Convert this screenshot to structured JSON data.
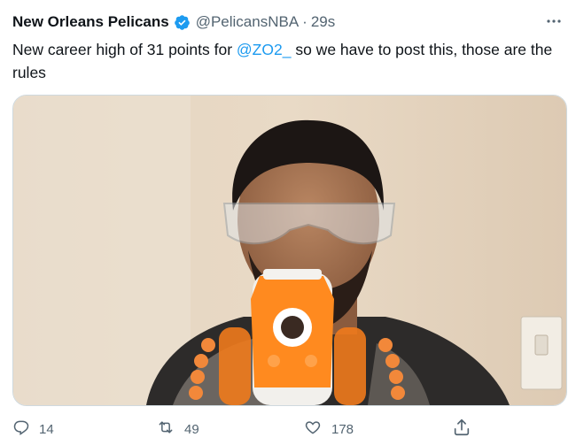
{
  "tweet": {
    "author_name": "New Orleans Pelicans",
    "handle": "@PelicansNBA",
    "separator": "·",
    "time": "29s",
    "text_before": "New career high of 31 points for ",
    "mention": "@ZO2_",
    "text_after": " so we have to post this, those are the rules",
    "media_description": "video still"
  },
  "icons": {
    "verified": "verified-badge-icon",
    "more": "more-options-icon",
    "reply": "reply-icon",
    "retweet": "retweet-icon",
    "like": "like-icon",
    "share": "share-icon"
  },
  "actions": {
    "replies": "14",
    "retweets": "49",
    "likes": "178"
  },
  "colors": {
    "accent": "#1d9bf0",
    "secondary_text": "#536471",
    "primary_text": "#0f1419",
    "border": "#cfd9de"
  }
}
